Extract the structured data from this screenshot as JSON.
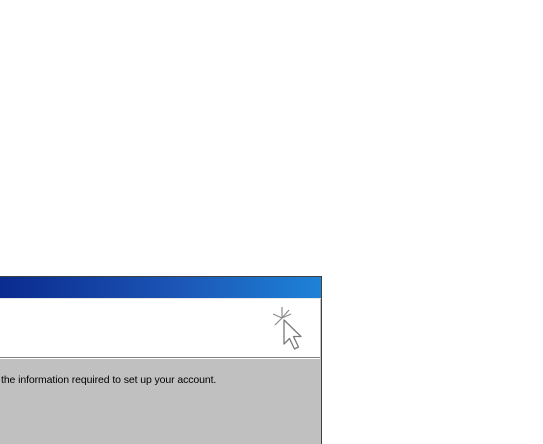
{
  "window": {
    "title": "",
    "header_icon": "pointer-click-icon"
  },
  "body": {
    "instruction": "the information required to set up your account."
  },
  "colors": {
    "title_bar_start": "#0a2a8e",
    "title_bar_end": "#1e82d6",
    "dialog_face": "#c0c0c0",
    "header_background": "#ffffff"
  }
}
